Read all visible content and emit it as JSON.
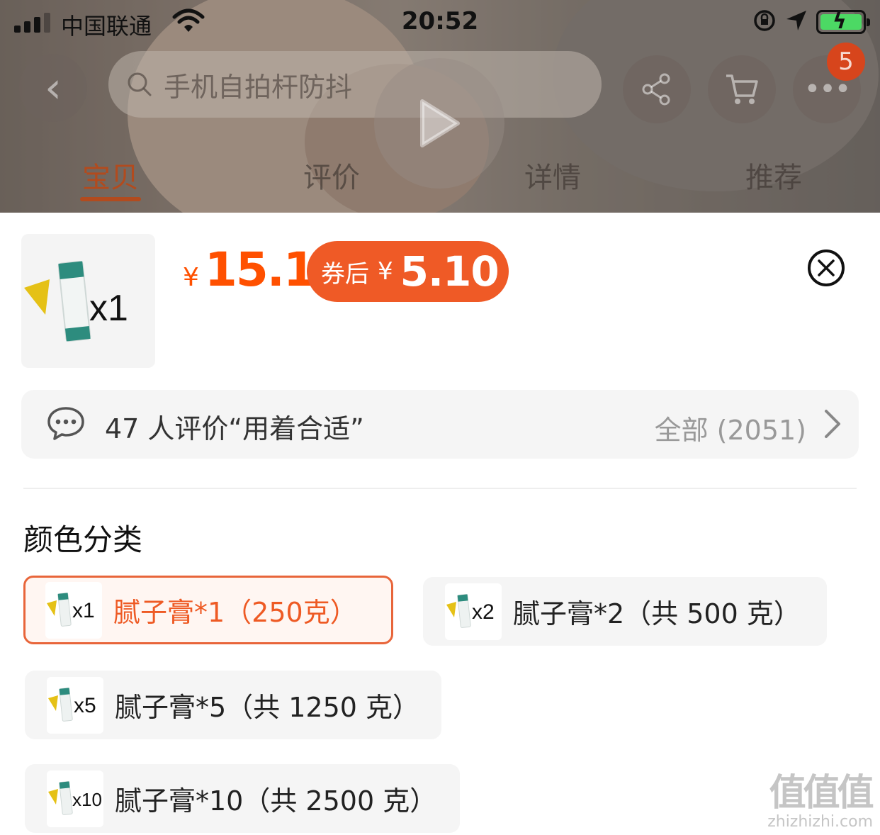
{
  "status_bar": {
    "carrier": "中国联通",
    "time": "20:52",
    "icons": [
      "signal-icon",
      "wifi-icon",
      "orientation-lock-icon",
      "location-arrow-icon",
      "battery-charging-icon"
    ]
  },
  "nav_bar": {
    "search_placeholder": "手机自拍杆防抖",
    "cart_badge": "5",
    "tabs": [
      {
        "label": "宝贝",
        "active": true
      },
      {
        "label": "评价",
        "active": false
      },
      {
        "label": "详情",
        "active": false
      },
      {
        "label": "推荐",
        "active": false
      }
    ]
  },
  "sheet": {
    "product_thumb_count": "x1",
    "price_symbol": "¥",
    "price": "15.1",
    "coupon_label": "券后",
    "coupon_symbol": "¥",
    "coupon_price": "5.10",
    "review_summary": "47 人评价“用着合适”",
    "review_all": "全部 (2051)",
    "section_title": "颜色分类",
    "options": [
      {
        "thumb": "x1",
        "label": "腻子膏*1（250克）",
        "selected": true
      },
      {
        "thumb": "x2",
        "label": "腻子膏*2（共 500 克）",
        "selected": false
      },
      {
        "thumb": "x5",
        "label": "腻子膏*5（共 1250 克）",
        "selected": false
      },
      {
        "thumb": "x10",
        "label": "腻子膏*10（共 2500 克）",
        "selected": false
      }
    ]
  },
  "colors": {
    "accent": "#ff5000",
    "coupon_bg": "#ef5a26",
    "selected_border": "#e8653a",
    "badge": "#d7451c"
  },
  "watermark": {
    "line1": "值值值",
    "line2": "zhizhizhi.com"
  }
}
